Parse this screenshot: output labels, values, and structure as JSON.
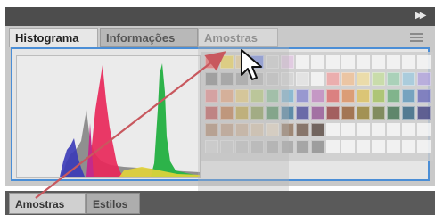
{
  "panel": {
    "tabs": [
      {
        "label": "Histograma",
        "active": true
      },
      {
        "label": "Informações",
        "active": false
      }
    ],
    "dragged_tab": {
      "label": "Amostras"
    },
    "menu_icon": "panel-menu-icon",
    "collapse_icon": "double-chevron-right-icon"
  },
  "bottom_panel": {
    "tabs": [
      {
        "label": "Amostras",
        "active": true
      },
      {
        "label": "Estilos",
        "active": false
      }
    ]
  },
  "colors": {
    "selection_border": "#4b8ed6",
    "drag_arrow": "#c8585e",
    "histogram_red": "#e8285a",
    "histogram_green": "#2db34a",
    "histogram_blue": "#3a3ab8",
    "histogram_yellow": "#e3d43a"
  },
  "swatch_palette": [
    [
      "#ff5050",
      "#ffe040",
      "#f6d890",
      "#6a80e8",
      "#d8d8d8",
      "#e9c9e9",
      "#ffffff",
      "#ffffff",
      "#ffffff",
      "#ffffff",
      "#ffffff",
      "#ffffff",
      "#ffffff",
      "#ffffff",
      "#ffffff"
    ],
    [
      "#7c7c7c",
      "#8d8d8d",
      "#a0a0a0",
      "#b4b4b4",
      "#c6c6c6",
      "#d9d9d9",
      "#ececec",
      "#ffffff",
      "#f6a0a0",
      "#f6c090",
      "#f6e29a",
      "#c6e29a",
      "#9ad2b0",
      "#9acae2",
      "#b0a0e2"
    ],
    [
      "#f08080",
      "#f0a070",
      "#f0d070",
      "#b8d070",
      "#80c090",
      "#70b0d0",
      "#8080d0",
      "#c080c0",
      "#e06060",
      "#e08850",
      "#e0c050",
      "#a0c050",
      "#60a870",
      "#5090b8",
      "#6060b8"
    ],
    [
      "#c04040",
      "#c06830",
      "#c0a030",
      "#809840",
      "#408850",
      "#307098",
      "#404098",
      "#904890",
      "#903030",
      "#905020",
      "#907820",
      "#607030",
      "#306840",
      "#205878",
      "#303078"
    ],
    [
      "#b08060",
      "#c09878",
      "#d0b090",
      "#e0c8a8",
      "#f0e0c8",
      "#8a6a50",
      "#6a5040",
      "#4a3830",
      "#ffffff",
      "#ffffff",
      "#ffffff",
      "#ffffff",
      "#ffffff",
      "#ffffff",
      "#ffffff"
    ],
    [
      "#dcdcdc",
      "#d0d0d0",
      "#c4c4c4",
      "#b8b8b8",
      "#acacac",
      "#a0a0a0",
      "#949494",
      "#888888",
      "#ffffff",
      "#ffffff",
      "#ffffff",
      "#ffffff",
      "#ffffff",
      "#ffffff",
      "#ffffff"
    ]
  ]
}
